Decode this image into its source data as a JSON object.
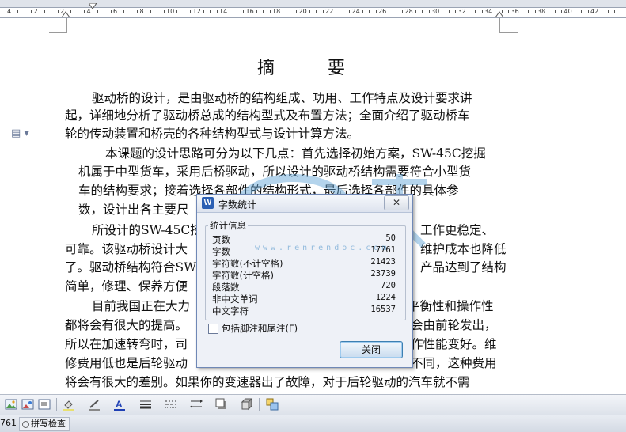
{
  "ruler": {
    "numbers": [
      "4",
      "2",
      "2",
      "4",
      "6",
      "8",
      "10",
      "12",
      "14",
      "16",
      "18",
      "20",
      "22",
      "24",
      "26",
      "28",
      "30",
      "32",
      "34",
      "36",
      "38",
      "40",
      "42"
    ]
  },
  "document": {
    "title": "摘  要",
    "lines": [
      "驱动桥的设计，是由驱动桥的结构组成、功用、工作特点及设计要求讲",
      "起，详细地分析了驱动桥总成的结构型式及布置方法；全面介绍了驱动桥车",
      "轮的传动装置和桥壳的各种结构型式与设计计算方法。",
      "本课题的设计思路可分为以下几点：首先选择初始方案，SW-45C挖掘",
      "机属于中型货车，采用后桥驱动，所以设计的驱动桥结构需要符合小型货",
      "车的结构要求；接着选择各部件的结构形式，最后选择各部件的具体参",
      "数，设计出各主要尺",
      "所设计的SW-45C挖",
      "工作更稳定、",
      "可靠。该驱动桥设计大",
      "维护成本也降低",
      "了。驱动桥结构符合SW",
      "产品达到了结构",
      "简单，修理、保养方便",
      "目前我国正在大力",
      "平衡性和操作性",
      "都将会有很大的提高。",
      "会由前轮发出，",
      "所以在加速转弯时，司",
      "作性能变好。维",
      "修费用低也是后轮驱动",
      "不同，这种费用",
      "将会有很大的差别。如果你的变速器出了故障，对于后轮驱动的汽车就不需"
    ]
  },
  "dialog": {
    "title": "字数统计",
    "close_glyph": "✕",
    "group_label": "统计信息",
    "stats": [
      {
        "label": "页数",
        "value": "50"
      },
      {
        "label": "字数",
        "value": "17761"
      },
      {
        "label": "字符数(不计空格)",
        "value": "21423"
      },
      {
        "label": "字符数(计空格)",
        "value": "23739"
      },
      {
        "label": "段落数",
        "value": "720"
      },
      {
        "label": "非中文单词",
        "value": "1224"
      },
      {
        "label": "中文字符",
        "value": "16537"
      }
    ],
    "checkbox_label": "包括脚注和尾注(F)",
    "checkbox_checked": false,
    "ok_label": "关闭"
  },
  "watermark": {
    "url_text": "www.renrendoc.com"
  },
  "toolbar": {
    "icons": [
      "insert-picture-icon",
      "picture-format-icon",
      "fill-color-icon",
      "line-color-icon",
      "font-color-icon",
      "line-style-icon",
      "dash-style-icon",
      "arrow-style-icon",
      "shadow-icon",
      "3d-icon",
      "group-icon"
    ],
    "font_color": "#1e3fb4"
  },
  "status": {
    "word_count": "761",
    "spell_check_label": "拼写检查"
  }
}
